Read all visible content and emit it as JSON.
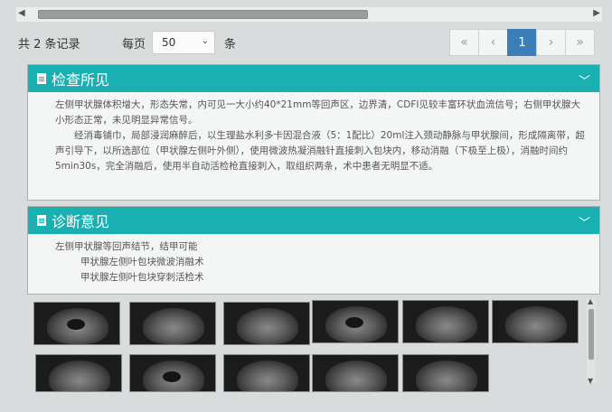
{
  "pagination": {
    "total_text": "共 2 条记录",
    "per_page_label": "每页",
    "per_page_value": "50",
    "unit": "条",
    "first": "«",
    "prev": "‹",
    "current": "1",
    "next": "›",
    "last": "»"
  },
  "findings": {
    "title": "检查所见",
    "line1": "左侧甲状腺体积增大，形态失常，内可见一大小约40*21mm等回声区，边界清，CDFI见较丰富环状血流信号；右侧甲状腺大小形态正常，未见明显异常信号。",
    "line2": "经消毒铺巾，局部浸润麻醉后，以生理盐水利多卡因混合液（5：1配比）20ml注入颈动静脉与甲状腺间，形成隔离带，超声引导下，以所选部位（甲状腺左侧叶外侧），使用微波热凝消融针直接刺入包块内，移动消融（下极至上极），消融时间约5min30s，完全消融后，使用半自动活检枪直接刺入，取组织两条，术中患者无明显不适。"
  },
  "diagnosis": {
    "title": "诊断意见",
    "line1": "左侧甲状腺等回声结节，结甲可能",
    "line2": "甲状腺左侧叶包块微波消融术",
    "line3": "甲状腺左侧叶包块穿刺活检术"
  },
  "icons": {
    "panel_icon": "document-icon",
    "collapse_icon": "chevron-down-icon"
  },
  "colors": {
    "panel_header": "#1ab0b2",
    "active_page": "#3a7fb8"
  }
}
